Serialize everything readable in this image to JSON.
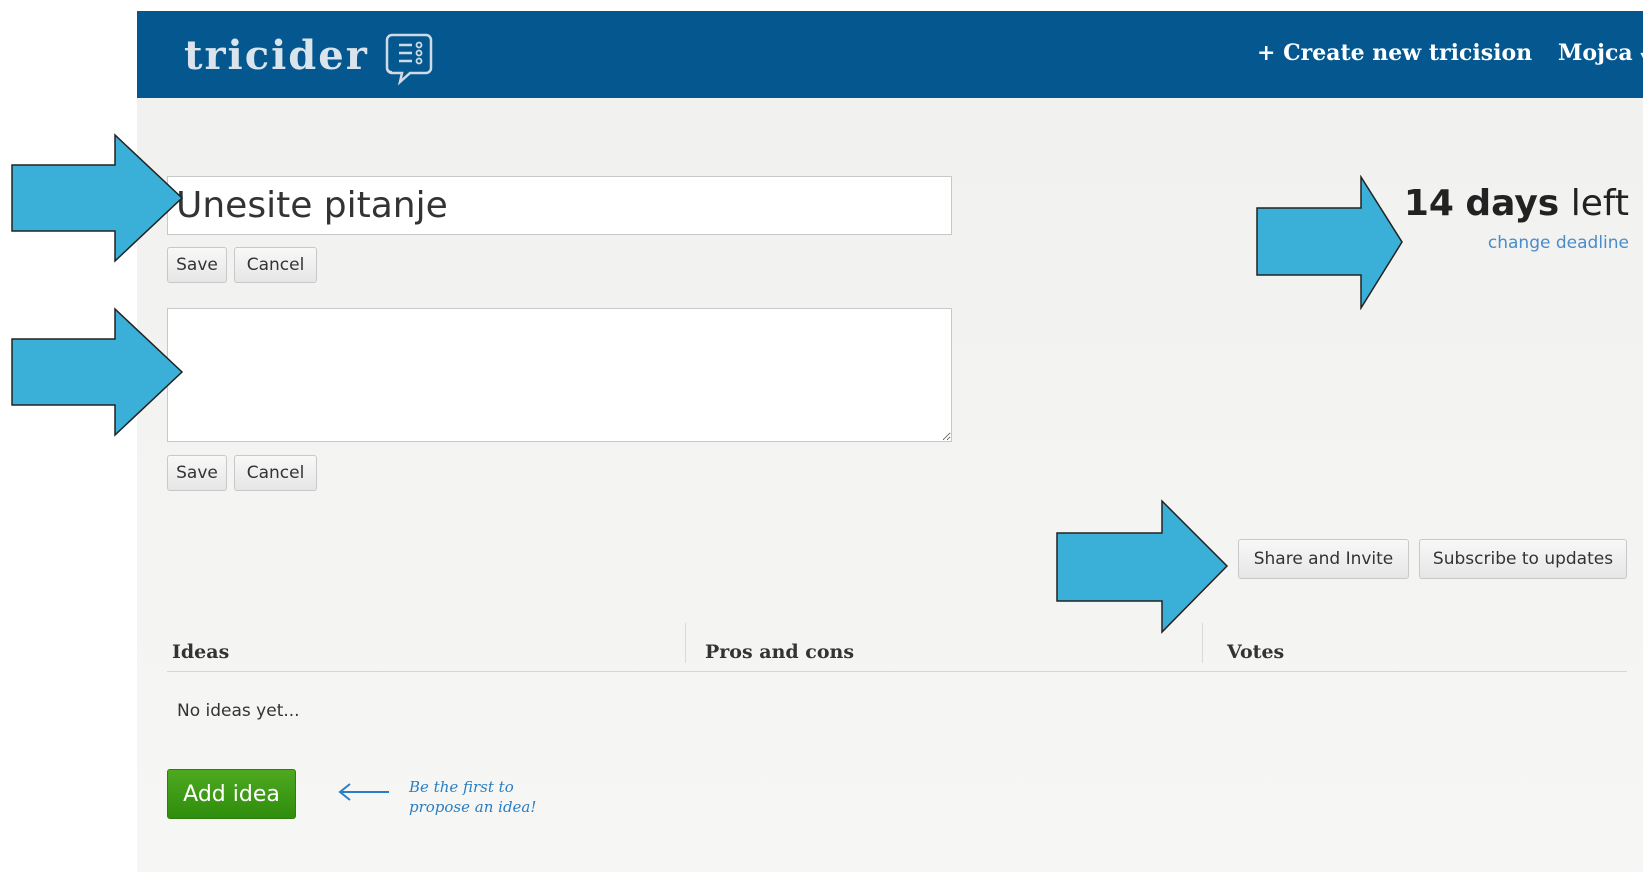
{
  "header": {
    "logo": "tricider",
    "create_label": "+ Create new tricision",
    "user_label": "Mojca"
  },
  "question": {
    "value": "Unesite pitanje",
    "save_label": "Save",
    "cancel_label": "Cancel"
  },
  "description": {
    "value": "",
    "save_label": "Save",
    "cancel_label": "Cancel"
  },
  "deadline": {
    "number": "14",
    "unit": "days",
    "suffix": "left",
    "change_label": "change deadline"
  },
  "actions": {
    "share_label": "Share and Invite",
    "subscribe_label": "Subscribe to updates"
  },
  "table": {
    "columns": [
      "Ideas",
      "Pros and cons",
      "Votes"
    ],
    "empty_text": "No ideas yet..."
  },
  "add_idea": {
    "label": "Add idea",
    "hint_line1": "Be the first to",
    "hint_line2": "propose an idea!"
  },
  "colors": {
    "header_bg": "#05578f",
    "add_idea_green": "#3a9a16",
    "link_blue": "#4a8bc9",
    "callout_arrow": "#3ab0d8"
  },
  "icons": [
    "chat-list-icon",
    "dropdown-caret-icon",
    "arrow-left-icon",
    "resize-handle-icon"
  ]
}
